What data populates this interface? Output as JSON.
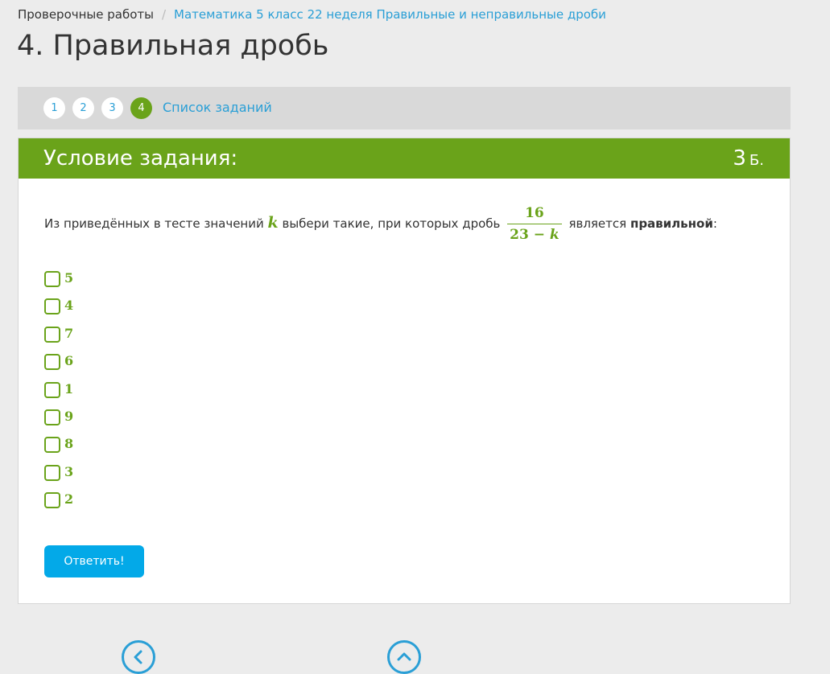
{
  "breadcrumb": {
    "root": "Проверочные работы",
    "separator": "/",
    "current": "Математика 5 класс 22 неделя Правильные и неправильные дроби"
  },
  "page_title": "4. Правильная дробь",
  "stepper": {
    "steps": [
      "1",
      "2",
      "3",
      "4"
    ],
    "active_step": "4",
    "task_list_link": "Список заданий"
  },
  "task": {
    "header_title": "Условие задания:",
    "points_value": "3",
    "points_unit": "Б.",
    "question": {
      "part1": "Из приведённых в тесте значений",
      "variable": "k",
      "part2": "выбери такие, при которых дробь",
      "fraction_numerator": "16",
      "fraction_denominator_prefix": "23 −",
      "fraction_denominator_var": "k",
      "part3": "является",
      "emphasis": "правильной",
      "suffix": ":"
    },
    "options": [
      "5",
      "4",
      "7",
      "6",
      "1",
      "9",
      "8",
      "3",
      "2"
    ],
    "submit_label": "Ответить!"
  },
  "colors": {
    "accent_green": "#6aa31a",
    "link_blue": "#2a9fd6",
    "button_blue": "#03a9e8",
    "page_background": "#ececec"
  },
  "icons": {
    "prev": "chevron-left-icon",
    "up": "chevron-up-icon"
  }
}
